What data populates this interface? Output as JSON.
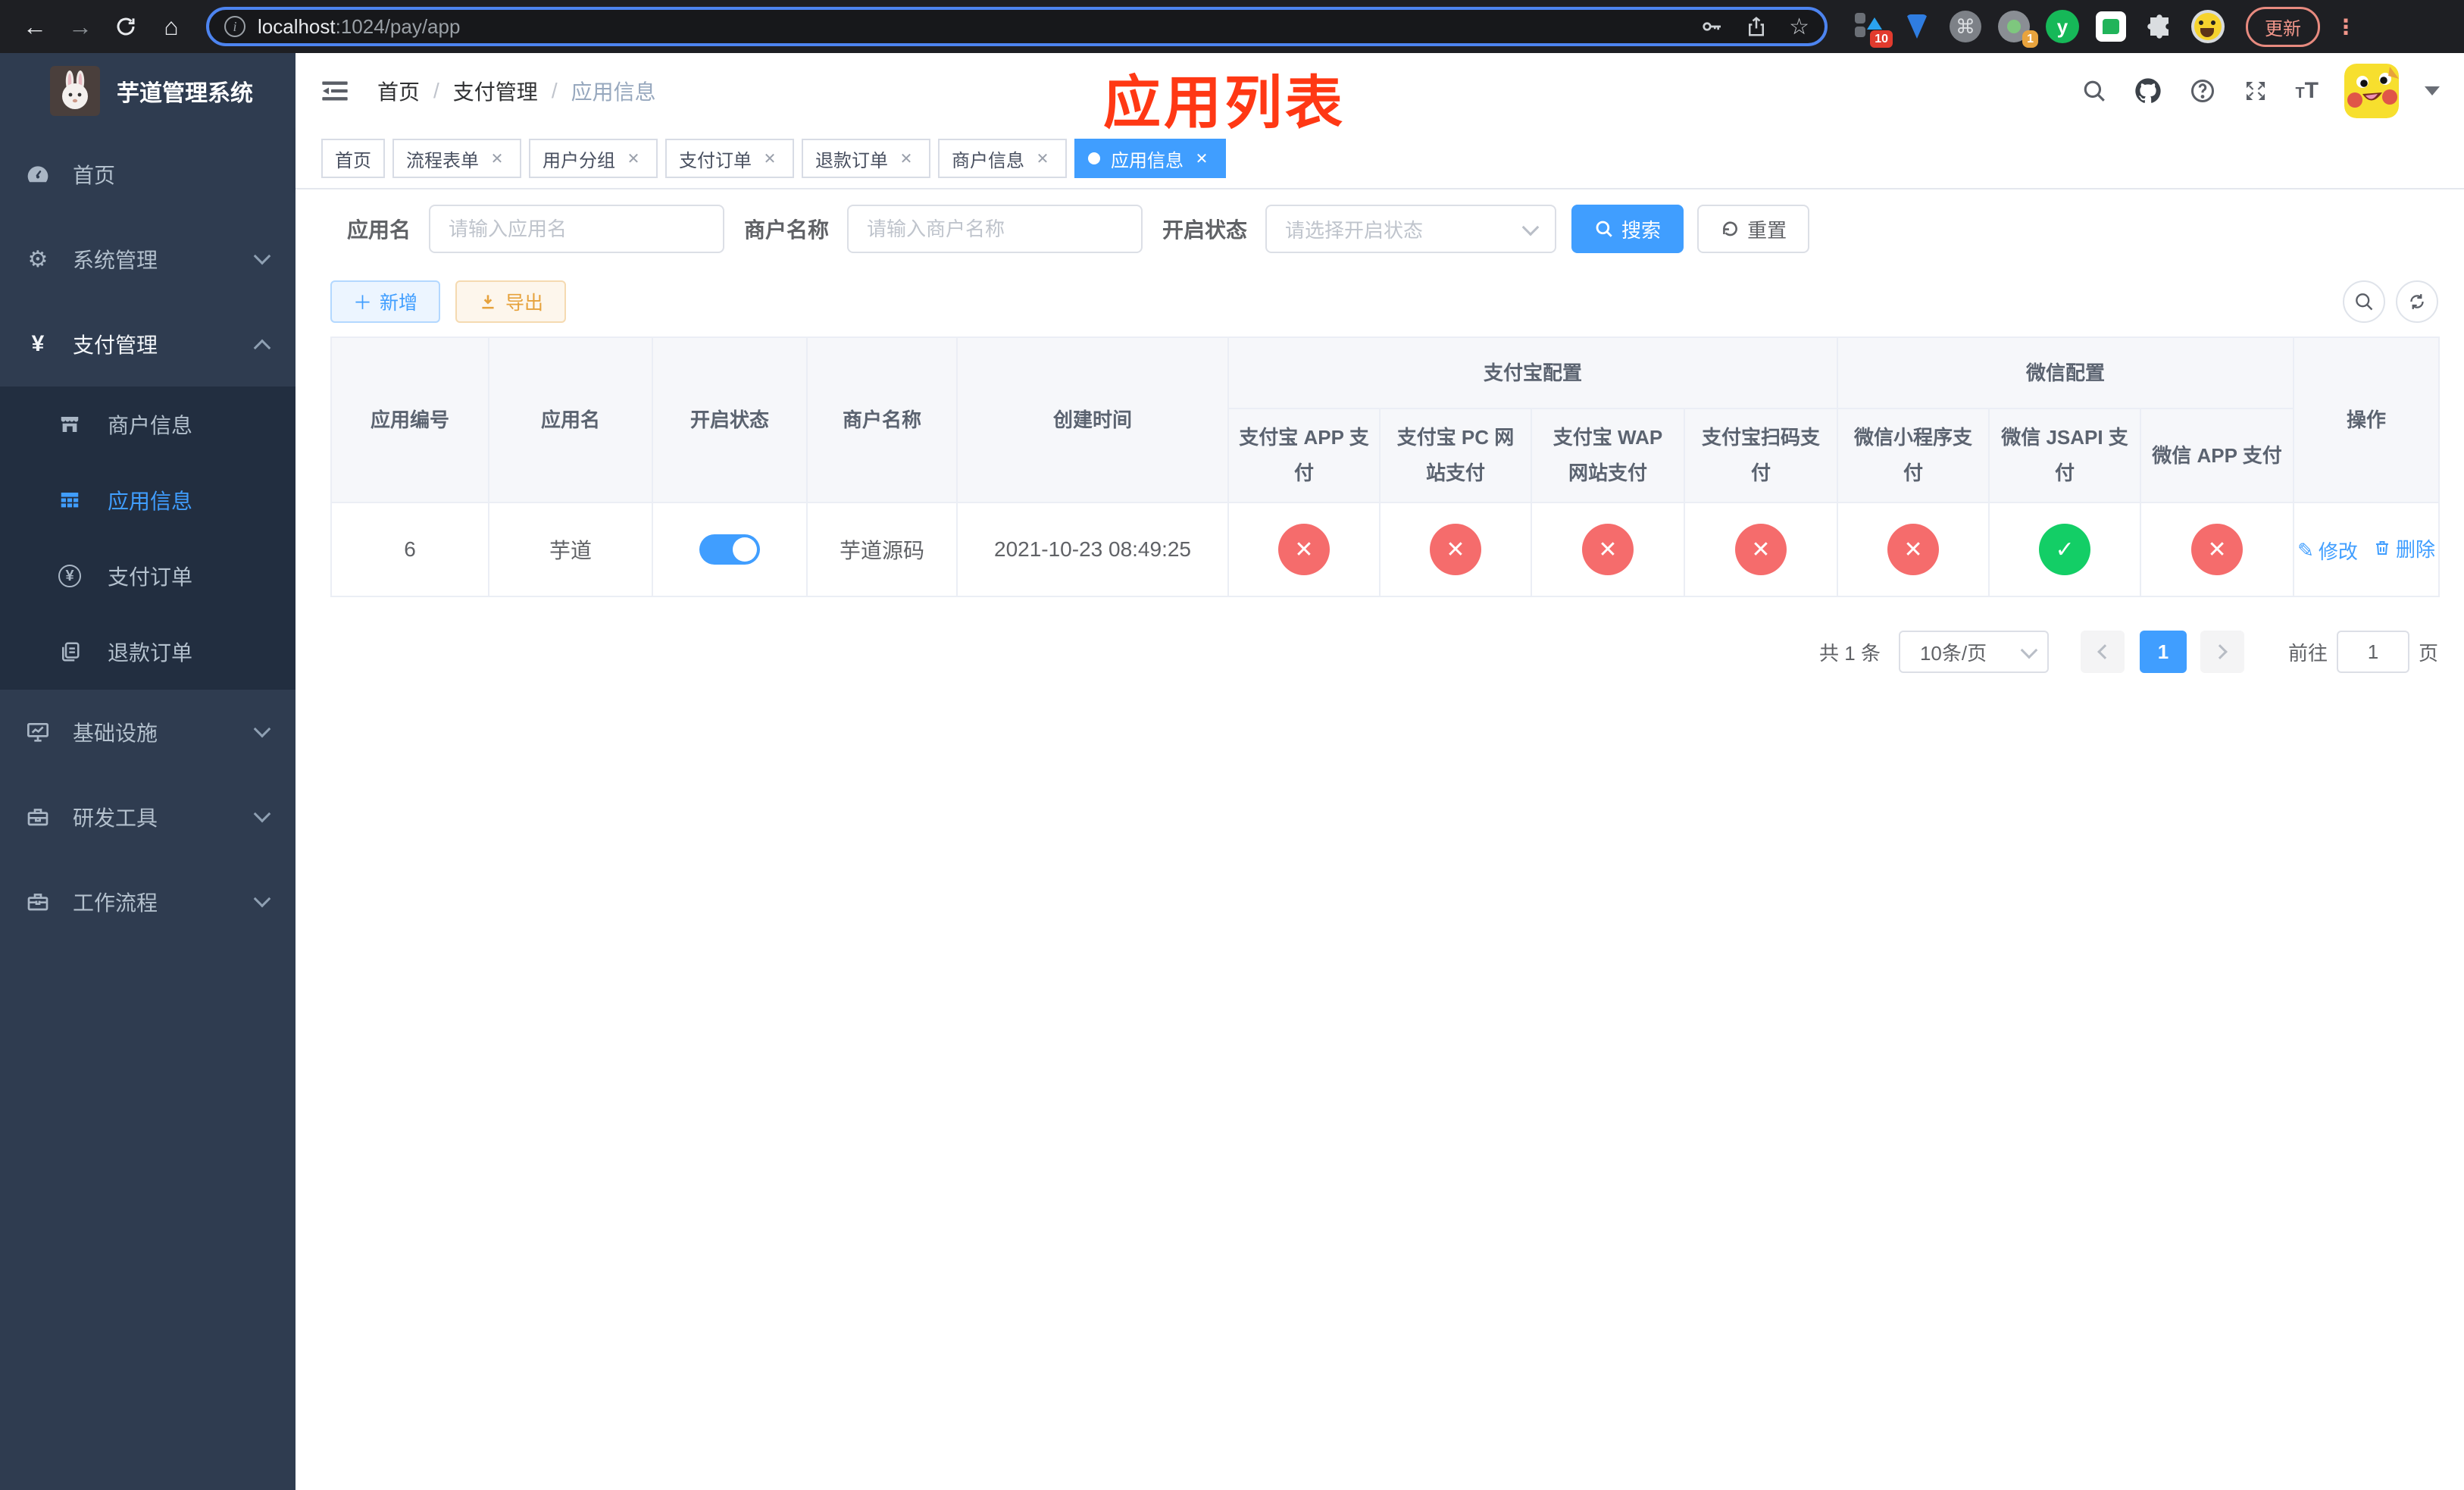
{
  "colors": {
    "accent": "#409eff",
    "danger": "#f56c6c",
    "success": "#13ce66",
    "warning": "#e6a23c",
    "sidebar_bg": "#2f3c50",
    "submenu_bg": "#222e40",
    "annotation_red": "#ff3814"
  },
  "icons": {
    "back": "←",
    "forward": "→",
    "home": "⌂",
    "star": "☆",
    "command": "⌘",
    "dots": "⋮",
    "slash": "/",
    "close": "✕",
    "check": "✓",
    "tag_close": "✕",
    "plus": "＋",
    "pencil": "✎",
    "yen": "¥",
    "question": "?",
    "info": "i",
    "big_t": "T",
    "small_t": "T",
    "ext_y": "y"
  },
  "browser": {
    "url_host": "localhost",
    "url_rest": ":1024/pay/app",
    "ext_badge_count": "10",
    "ext_dot_badge": "1",
    "update_button": "更新"
  },
  "sidebar": {
    "title": "芋道管理系统",
    "items": [
      {
        "label": "首页",
        "icon": "dashboard-icon"
      },
      {
        "label": "系统管理",
        "icon": "gear-icon"
      },
      {
        "label": "支付管理",
        "icon": "yen-icon",
        "expanded": true,
        "children": [
          {
            "label": "商户信息",
            "icon": "shop-icon"
          },
          {
            "label": "应用信息",
            "icon": "grid-icon",
            "active": true
          },
          {
            "label": "支付订单",
            "icon": "yen-circle-icon"
          },
          {
            "label": "退款订单",
            "icon": "documents-icon"
          }
        ]
      },
      {
        "label": "基础设施",
        "icon": "monitor-icon"
      },
      {
        "label": "研发工具",
        "icon": "toolbox-icon"
      },
      {
        "label": "工作流程",
        "icon": "briefcase-icon"
      }
    ]
  },
  "header": {
    "breadcrumb": [
      "首页",
      "支付管理",
      "应用信息"
    ],
    "annotation": "应用列表"
  },
  "tabs": [
    {
      "label": "首页",
      "closable": false,
      "active": false
    },
    {
      "label": "流程表单",
      "closable": true,
      "active": false
    },
    {
      "label": "用户分组",
      "closable": true,
      "active": false
    },
    {
      "label": "支付订单",
      "closable": true,
      "active": false
    },
    {
      "label": "退款订单",
      "closable": true,
      "active": false
    },
    {
      "label": "商户信息",
      "closable": true,
      "active": false
    },
    {
      "label": "应用信息",
      "closable": true,
      "active": true
    }
  ],
  "filters": {
    "app_name_label": "应用名",
    "app_name_placeholder": "请输入应用名",
    "merchant_label": "商户名称",
    "merchant_placeholder": "请输入商户名称",
    "status_label": "开启状态",
    "status_placeholder": "请选择开启状态",
    "search_label": "搜索",
    "reset_label": "重置"
  },
  "toolbar": {
    "add_label": "新增",
    "export_label": "导出"
  },
  "table": {
    "columns": [
      "应用编号",
      "应用名",
      "开启状态",
      "商户名称",
      "创建时间"
    ],
    "groups": [
      {
        "label": "支付宝配置",
        "children": [
          "支付宝 APP 支付",
          "支付宝 PC 网站支付",
          "支付宝 WAP 网站支付",
          "支付宝扫码支付"
        ]
      },
      {
        "label": "微信配置",
        "children": [
          "微信小程序支付",
          "微信 JSAPI 支付",
          "微信 APP 支付"
        ]
      }
    ],
    "action_label": "操作",
    "row": {
      "id": "6",
      "name": "芋道",
      "enabled": true,
      "merchant": "芋道源码",
      "created": "2021-10-23 08:49:25",
      "statuses": [
        "no",
        "no",
        "no",
        "no",
        "no",
        "yes",
        "no"
      ],
      "edit_label": "修改",
      "delete_label": "删除"
    }
  },
  "pagination": {
    "total": "共 1 条",
    "page_size": "10条/页",
    "page": "1",
    "goto_label": "前往",
    "goto_value": "1",
    "page_suffix": "页"
  }
}
